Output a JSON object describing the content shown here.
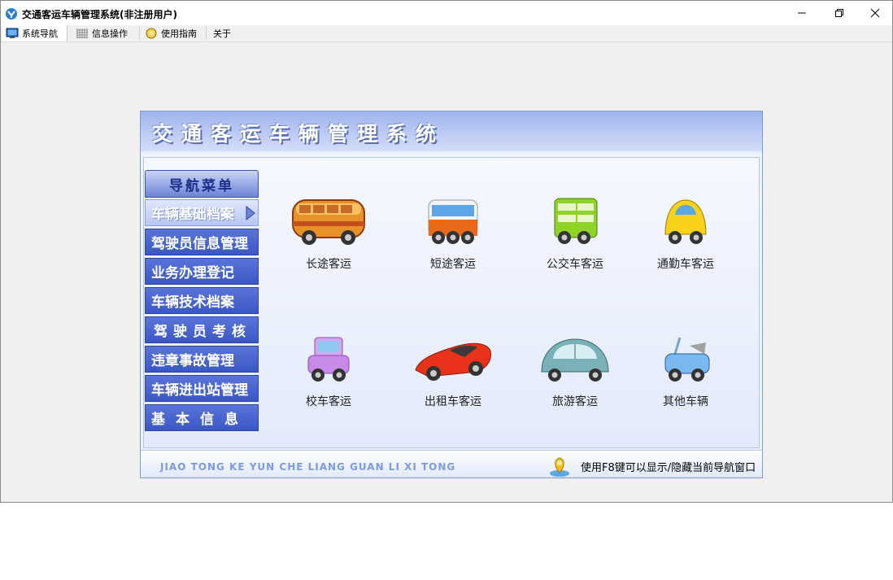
{
  "window": {
    "title": "交通客运车辆管理系统(非注册用户)",
    "controls": [
      "minimize-icon",
      "restore-icon",
      "close-icon"
    ]
  },
  "tabs": [
    {
      "label": "系统导航",
      "icon": "monitor-icon",
      "active": true
    },
    {
      "label": "信息操作",
      "icon": "grid-icon",
      "active": false
    },
    {
      "label": "使用指南",
      "icon": "help-globe-icon",
      "active": false
    },
    {
      "label": "关于",
      "icon": "",
      "active": false
    }
  ],
  "panel": {
    "title": "交通客运车辆管理系统",
    "nav_header": "导航菜单",
    "nav_items": [
      {
        "label": "车辆基础档案",
        "active": true
      },
      {
        "label": "驾驶员信息管理",
        "active": false
      },
      {
        "label": "业务办理登记",
        "active": false
      },
      {
        "label": "车辆技术档案",
        "active": false
      },
      {
        "label": "驾驶员考核",
        "active": false
      },
      {
        "label": "违章事故管理",
        "active": false
      },
      {
        "label": "车辆进出站管理",
        "active": false
      },
      {
        "label": "基本信息",
        "active": false
      }
    ],
    "tiles": [
      {
        "label": "长途客运",
        "icon": "coach-bus-icon"
      },
      {
        "label": "短途客运",
        "icon": "minibus-icon"
      },
      {
        "label": "公交车客运",
        "icon": "double-decker-bus-icon"
      },
      {
        "label": "通勤车客运",
        "icon": "small-car-icon"
      },
      {
        "label": "校车客运",
        "icon": "school-car-icon"
      },
      {
        "label": "出租车客运",
        "icon": "sports-car-icon"
      },
      {
        "label": "旅游客运",
        "icon": "tour-car-icon"
      },
      {
        "label": "其他车辆",
        "icon": "convertible-icon"
      }
    ],
    "footer_text": "JIAO TONG KE YUN CHE LIANG GUAN LI XI TONG",
    "hint": "使用F8键可以显示/隐藏当前导航窗口"
  },
  "colors": {
    "nav_blue": "#3b57c4",
    "header_blue": "#9eb4ec",
    "footer_text": "#7d9be0"
  }
}
